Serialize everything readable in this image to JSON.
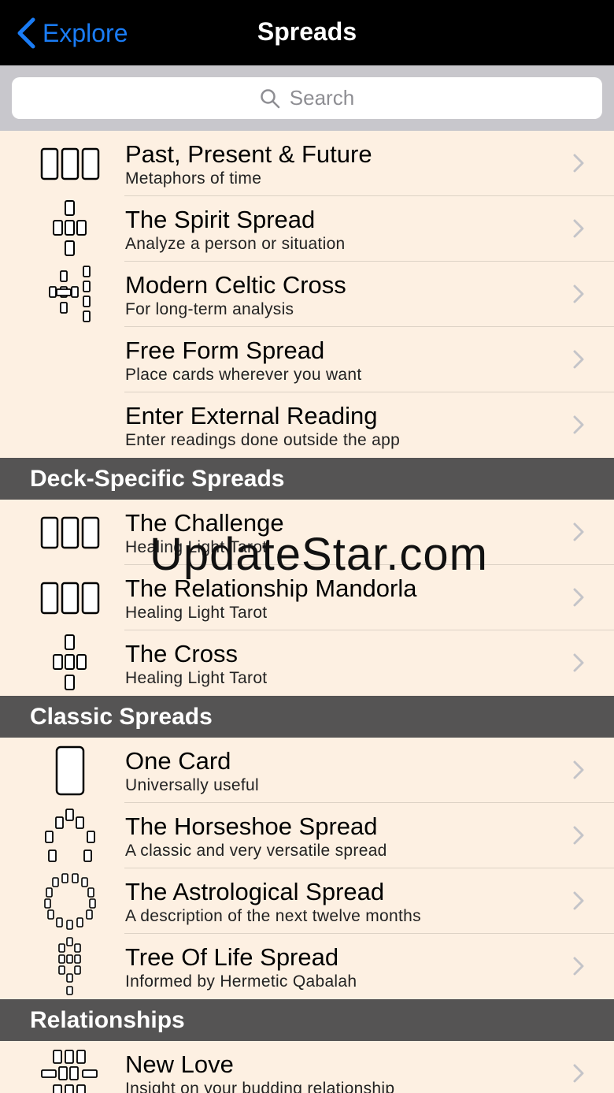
{
  "nav": {
    "back_label": "Explore",
    "title": "Spreads"
  },
  "search": {
    "placeholder": "Search"
  },
  "main_rows": [
    {
      "title": "Past, Present & Future",
      "subtitle": "Metaphors of time",
      "icon": "three-card-spread-icon"
    },
    {
      "title": "The Spirit Spread",
      "subtitle": "Analyze a person or situation",
      "icon": "cross-spread-icon"
    },
    {
      "title": "Modern Celtic Cross",
      "subtitle": "For long-term analysis",
      "icon": "celtic-cross-icon"
    },
    {
      "title": "Free Form Spread",
      "subtitle": "Place cards wherever you want",
      "icon": ""
    },
    {
      "title": "Enter External Reading",
      "subtitle": "Enter readings done outside the app",
      "icon": ""
    }
  ],
  "sections": {
    "deck_specific": "Deck-Specific Spreads",
    "classic": "Classic Spreads",
    "relationships": "Relationships"
  },
  "deck_rows": [
    {
      "title": "The Challenge",
      "subtitle": "Healing Light Tarot",
      "icon": "three-card-spread-icon"
    },
    {
      "title": "The Relationship Mandorla",
      "subtitle": "Healing Light Tarot",
      "icon": "three-card-spread-icon"
    },
    {
      "title": "The Cross",
      "subtitle": "Healing Light Tarot",
      "icon": "cross-spread-icon"
    }
  ],
  "classic_rows": [
    {
      "title": "One Card",
      "subtitle": "Universally useful",
      "icon": "one-card-icon"
    },
    {
      "title": "The Horseshoe Spread",
      "subtitle": "A classic and very versatile spread",
      "icon": "horseshoe-spread-icon"
    },
    {
      "title": "The Astrological Spread",
      "subtitle": "A description of the next twelve months",
      "icon": "astrological-spread-icon"
    },
    {
      "title": "Tree Of Life Spread",
      "subtitle": "Informed by Hermetic Qabalah",
      "icon": "tree-of-life-icon"
    }
  ],
  "relationship_rows": [
    {
      "title": "New Love",
      "subtitle": "Insight on your budding relationship",
      "icon": "new-love-spread-icon"
    }
  ],
  "watermark": "UpdateStar.com",
  "colors": {
    "accent": "#1a7cf5",
    "row_bg": "#fdf0e2",
    "section_bg": "#555454",
    "navbar_bg": "#000000"
  }
}
